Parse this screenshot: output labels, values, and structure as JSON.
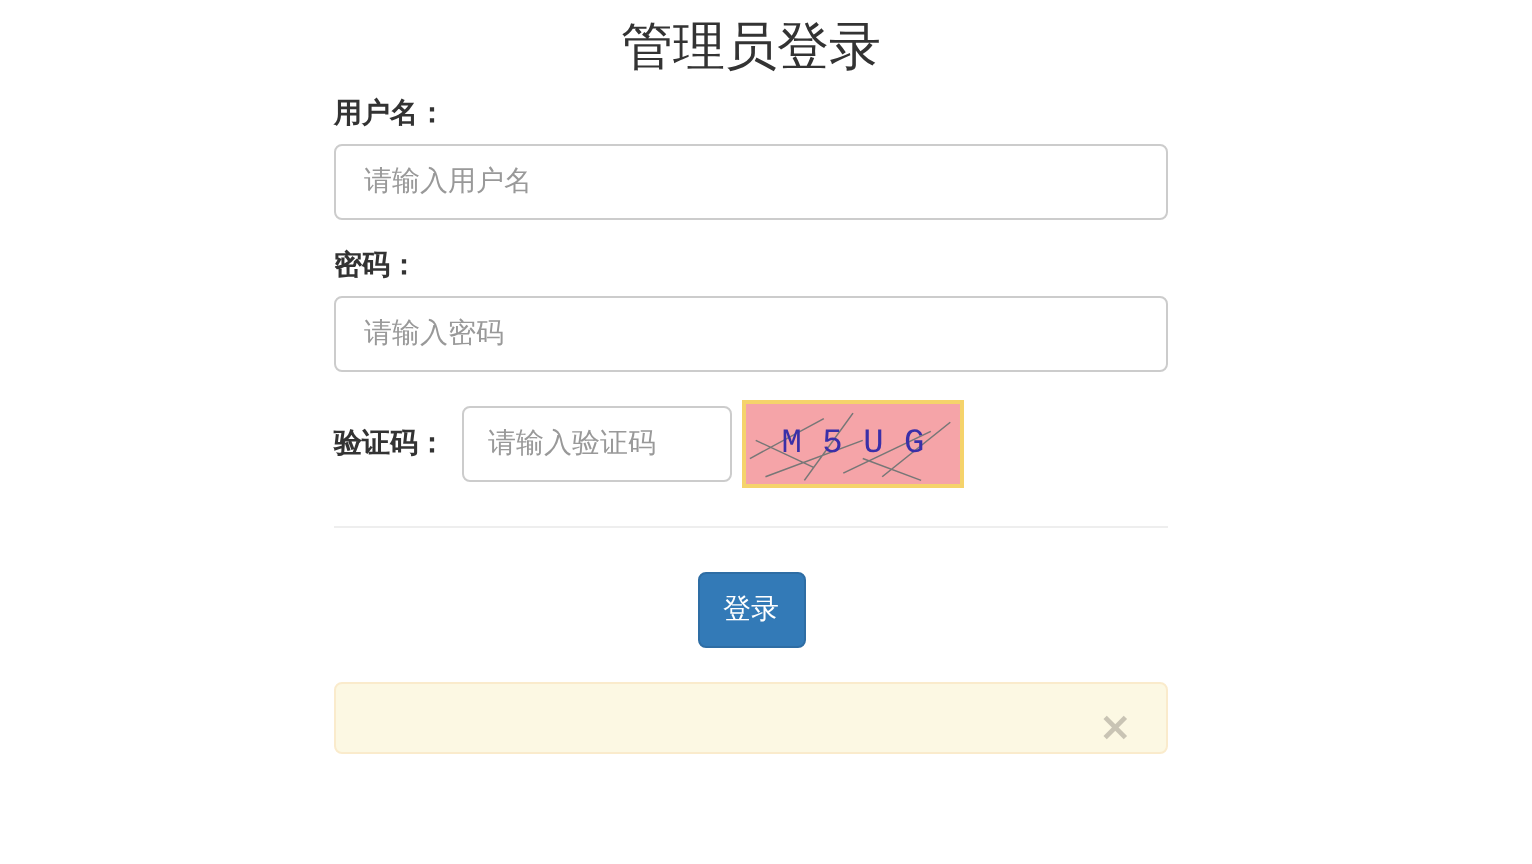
{
  "title": "管理员登录",
  "fields": [
    {
      "label": "用户名：",
      "placeholder": "请输入用户名"
    },
    {
      "label": "密码：",
      "placeholder": "请输入密码"
    }
  ],
  "captcha": {
    "label": "验证码：",
    "placeholder": "请输入验证码",
    "code": "M 5 U G"
  },
  "submit": "登录",
  "alert": {
    "close": "×"
  }
}
